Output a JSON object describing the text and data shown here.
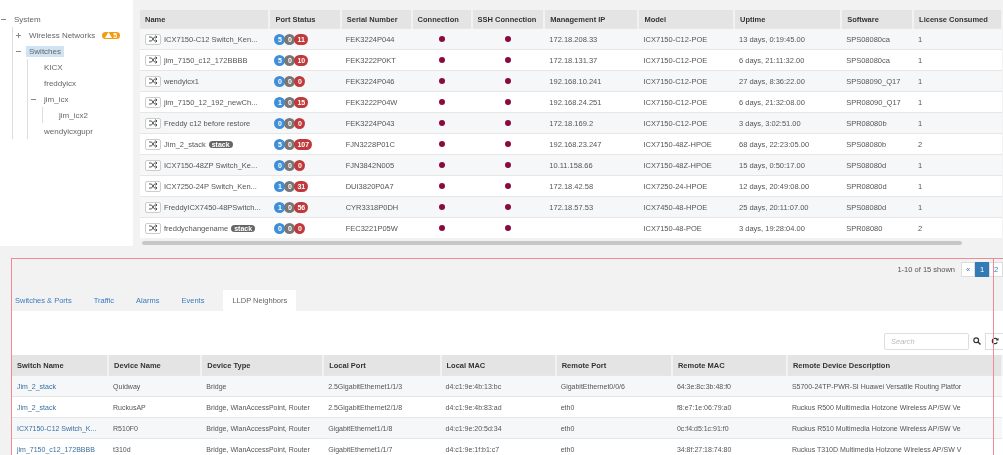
{
  "tree": [
    {
      "label": "System",
      "expanded": true,
      "selected": false,
      "children": [
        {
          "label": "Wireless Networks",
          "expanded": false,
          "selected": false,
          "alert": "5"
        },
        {
          "label": "Switches",
          "expanded": true,
          "selected": true,
          "children": [
            {
              "label": "KICX",
              "selected": false
            },
            {
              "label": "freddyicx",
              "selected": false
            },
            {
              "label": "jim_icx",
              "expanded": true,
              "selected": false,
              "children": [
                {
                  "label": "jim_icx2",
                  "selected": false
                }
              ]
            },
            {
              "label": "wendyicxgupr",
              "selected": false
            }
          ]
        }
      ]
    }
  ],
  "switch_table": {
    "columns": [
      "Name",
      "Port Status",
      "Serial Number",
      "Connection",
      "SSH Connection",
      "Management IP",
      "Model",
      "Uptime",
      "Software",
      "License Consumed"
    ],
    "rows": [
      {
        "name": "ICX7150-C12 Switch_Ken...",
        "ports": {
          "up": "5",
          "down": "0",
          "error": "11"
        },
        "serial": "FEK3224P044",
        "connection": {
          "color": "#8a0a3f"
        },
        "ssh": {
          "color": "#8a0a3f"
        },
        "ip": "172.18.208.33",
        "model": "ICX7150-C12-POE",
        "uptime": "13 days, 0:19:45.00",
        "software": "SPS08080ca",
        "license": "1"
      },
      {
        "name": "jim_7150_c12_172BBBB",
        "ports": {
          "up": "5",
          "down": "0",
          "error": "10"
        },
        "serial": "FEK3222P0KT",
        "connection": {
          "color": "#8a0a3f"
        },
        "ssh": {
          "color": "#8a0a3f"
        },
        "ip": "172.18.131.37",
        "model": "ICX7150-C12-POE",
        "uptime": "6 days, 21:11:32.00",
        "software": "SPS08080ca",
        "license": "1"
      },
      {
        "name": "wendyicx1",
        "ports": {
          "up": "0",
          "down": "0",
          "error": "0"
        },
        "serial": "FEK3224P046",
        "connection": {
          "color": "#8a0a3f"
        },
        "ssh": {
          "color": "#8a0a3f"
        },
        "ip": "192.168.10.241",
        "model": "ICX7150-C12-POE",
        "uptime": "27 days, 8:36:22.00",
        "software": "SPS08090_Q17",
        "license": "1"
      },
      {
        "name": "jim_7150_12_192_newCh...",
        "ports": {
          "up": "1",
          "down": "0",
          "error": "15"
        },
        "serial": "FEK3222P04W",
        "connection": {
          "color": "#8a0a3f"
        },
        "ssh": {
          "color": "#8a0a3f"
        },
        "ip": "192.168.24.251",
        "model": "ICX7150-C12-POE",
        "uptime": "6 days, 21:32:08.00",
        "software": "SPR08090_Q17",
        "license": "1"
      },
      {
        "name": "Freddy c12 before restore",
        "ports": {
          "up": "0",
          "down": "0",
          "error": "0"
        },
        "serial": "FEK3224P043",
        "connection": {
          "color": "#8a0a3f"
        },
        "ssh": {
          "color": "#8a0a3f"
        },
        "ip": "172.18.169.2",
        "model": "ICX7150-C12-POE",
        "uptime": "3 days, 3:02:51.00",
        "software": "SPR08080b",
        "license": "1"
      },
      {
        "name": "Jim_2_stack",
        "tag": "stack",
        "ports": {
          "up": "5",
          "down": "0",
          "error": "107"
        },
        "serial": "FJN3228P01C",
        "connection": {
          "color": "#8a0a3f"
        },
        "ssh": {
          "color": "#8a0a3f"
        },
        "ip": "192.168.23.247",
        "model": "ICX7150-48Z-HPOE",
        "uptime": "68 days, 22:23:05.00",
        "software": "SPS08080b",
        "license": "2"
      },
      {
        "name": "ICX7150-48ZP Switch_Ke...",
        "ports": {
          "up": "0",
          "down": "0",
          "error": "0"
        },
        "serial": "FJN3842N005",
        "connection": {
          "color": "#8a0a3f"
        },
        "ssh": {
          "color": "#8a0a3f"
        },
        "ip": "10.11.158.66",
        "model": "ICX7150-48Z-HPOE",
        "uptime": "15 days, 0:50:17.00",
        "software": "SPS08080d",
        "license": "1"
      },
      {
        "name": "ICX7250-24P Switch_Ken...",
        "ports": {
          "up": "1",
          "down": "0",
          "error": "31"
        },
        "serial": "DUI3820P0A7",
        "connection": {
          "color": "#8a0a3f"
        },
        "ssh": {
          "color": "#8a0a3f"
        },
        "ip": "172.18.42.58",
        "model": "ICX7250-24-HPOE",
        "uptime": "12 days, 20:49:08.00",
        "software": "SPR08080d",
        "license": "1"
      },
      {
        "name": "FreddyICX7450-48PSwitch...",
        "ports": {
          "up": "1",
          "down": "0",
          "error": "56"
        },
        "serial": "CYR3318P0DH",
        "connection": {
          "color": "#8a0a3f"
        },
        "ssh": {
          "color": "#8a0a3f"
        },
        "ip": "172.18.57.53",
        "model": "ICX7450-48-HPOE",
        "uptime": "25 days, 20:11:07.00",
        "software": "SPS08080d",
        "license": "1"
      },
      {
        "name": "freddychangename",
        "tag": "stack",
        "ports": {
          "up": "0",
          "down": "0",
          "error": "0"
        },
        "serial": "FEC3221P05W",
        "connection": {
          "color": "#8a0a3f"
        },
        "ssh": {
          "color": "#8a0a3f"
        },
        "model": "ICX7150-48-POE",
        "uptime": "3 days, 19:28:04.00",
        "software": "SPR08080",
        "license": "2"
      }
    ]
  },
  "pagination": {
    "summary": "1-10 of 15 shown",
    "prev": "«",
    "pages": [
      {
        "label": "1",
        "selected": true
      },
      {
        "label": "2",
        "selected": false
      }
    ]
  },
  "tabs": [
    {
      "label": "Switches & Ports",
      "selected": false
    },
    {
      "label": "Traffic",
      "selected": false
    },
    {
      "label": "Alarms",
      "selected": false
    },
    {
      "label": "Events",
      "selected": false
    },
    {
      "label": "LLDP Neighbors",
      "selected": true
    }
  ],
  "search": {
    "placeholder": "Search"
  },
  "lldp_table": {
    "columns": [
      "Switch Name",
      "Device Name",
      "Device Type",
      "Local Port",
      "Local MAC",
      "Remote Port",
      "Remote MAC",
      "Remote Device Description"
    ],
    "rows": [
      [
        "Jim_2_stack",
        "Quidway",
        "Bridge",
        "2.5GigabitEthernet1/1/3",
        "d4:c1:9e:4b:13:bc",
        "GigabitEthernet0/0/6",
        "64:3e:8c:3b:48:f0",
        "S5700-24TP-PWR-SI Huawei Versatile Routing Platfor"
      ],
      [
        "Jim_2_stack",
        "RuckusAP",
        "Bridge, WlanAccessPoint, Router",
        "2.5GigabitEthernet2/1/8",
        "d4:c1:9e:4b:83:ad",
        "eth0",
        "f8:e7:1e:06:79:a0",
        "Ruckus R500 Multimedia Hotzone Wireless AP/SW Ve"
      ],
      [
        "ICX7150-C12 Switch_K...",
        "R510F0",
        "Bridge, WlanAccessPoint, Router",
        "GigabitEthernet1/1/8",
        "d4:c1:9e:20:5d:34",
        "eth0",
        "0c:f4:d5:1c:91:f0",
        "Ruckus R510 Multimedia Hotzone Wireless AP/SW Ve"
      ],
      [
        "jim_7150_c12_172BBBB",
        "t310d",
        "Bridge, WlanAccessPoint, Router",
        "GigabitEthernet1/1/7",
        "d4:c1:9e:1f:b1:c7",
        "eth0",
        "34:8f:27:18:74:80",
        "Ruckus T310D Multimedia Hotzone Wireless AP/SW V"
      ]
    ]
  }
}
